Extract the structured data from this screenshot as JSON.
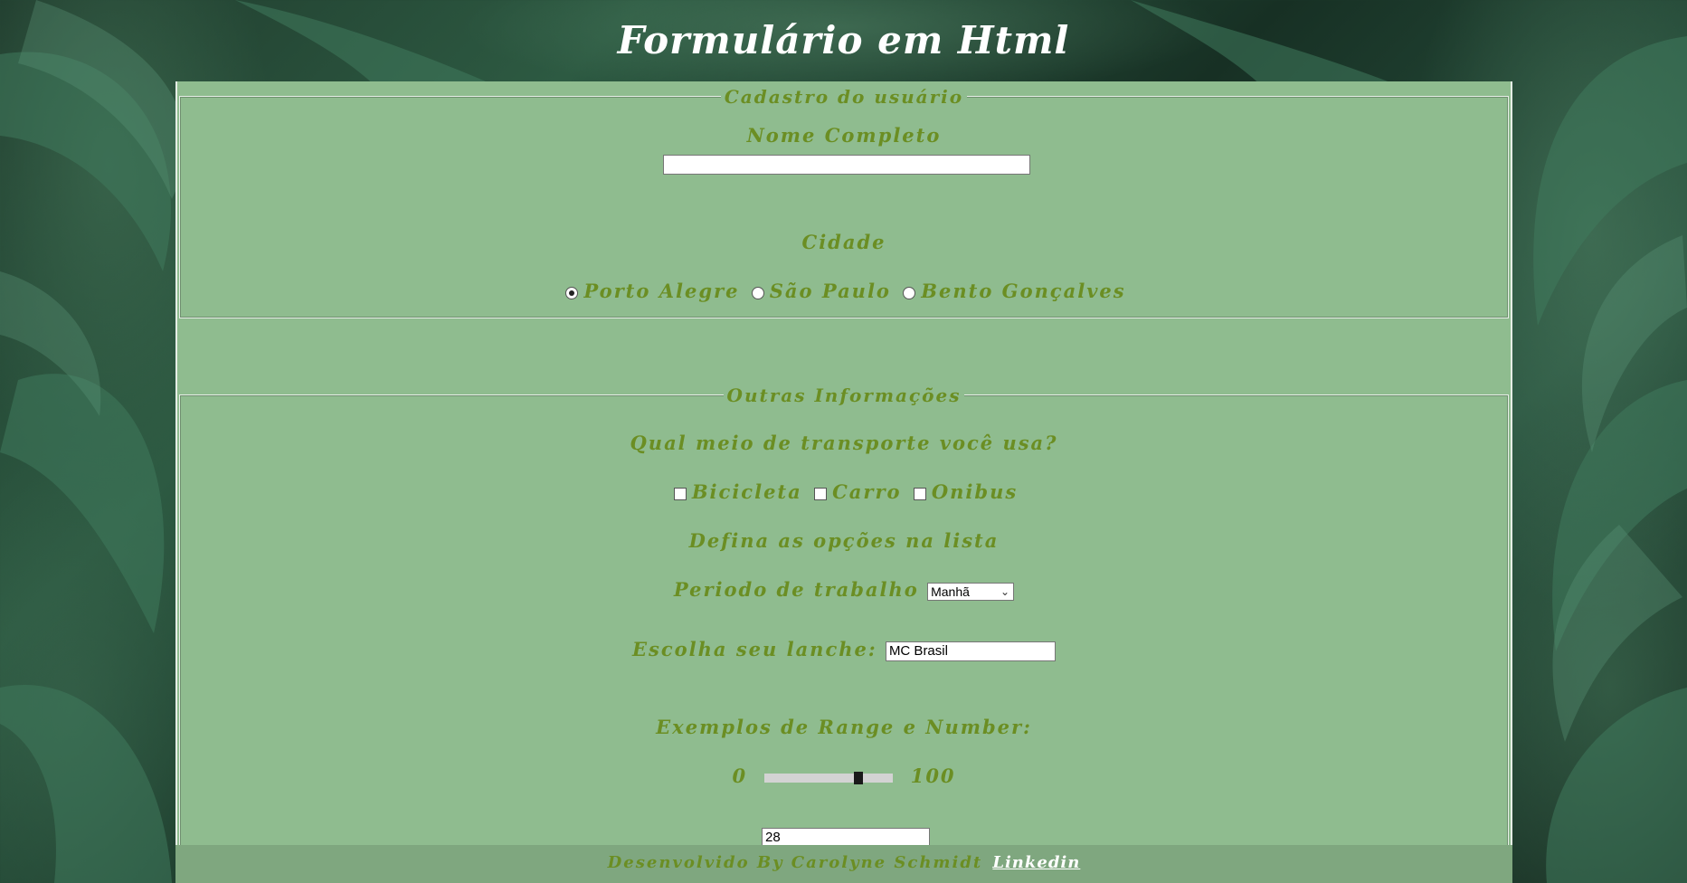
{
  "page": {
    "title": "Formulário em Html"
  },
  "fieldset_user": {
    "legend": "Cadastro do usuário",
    "name_label": "Nome Completo",
    "name_value": "",
    "city_label": "Cidade",
    "cities": [
      {
        "label": "Porto Alegre",
        "checked": true
      },
      {
        "label": "São Paulo",
        "checked": false
      },
      {
        "label": "Bento Gonçalves",
        "checked": false
      }
    ]
  },
  "fieldset_other": {
    "legend": "Outras Informações",
    "transport_question": "Qual meio de transporte você usa?",
    "transports": [
      {
        "label": "Bicicleta",
        "checked": false
      },
      {
        "label": "Carro",
        "checked": false
      },
      {
        "label": "Onibus",
        "checked": false
      }
    ],
    "list_heading": "Defina as opções na lista",
    "period_label": "Periodo de trabalho",
    "period_selected": "Manhã",
    "snack_label": "Escolha seu lanche:",
    "snack_value": "MC Brasil",
    "range_heading": "Exemplos de Range e Number:",
    "range_min": "0",
    "range_max": "100",
    "range_value_fraction": 0.75,
    "number_value": "28"
  },
  "footer": {
    "text": "Desenvolvido By Carolyne Schmidt",
    "link_label": "Linkedin"
  },
  "colors": {
    "panel_bg": "#8fbc8f",
    "label_text": "#6b8e23",
    "title_text": "#ffffff"
  }
}
